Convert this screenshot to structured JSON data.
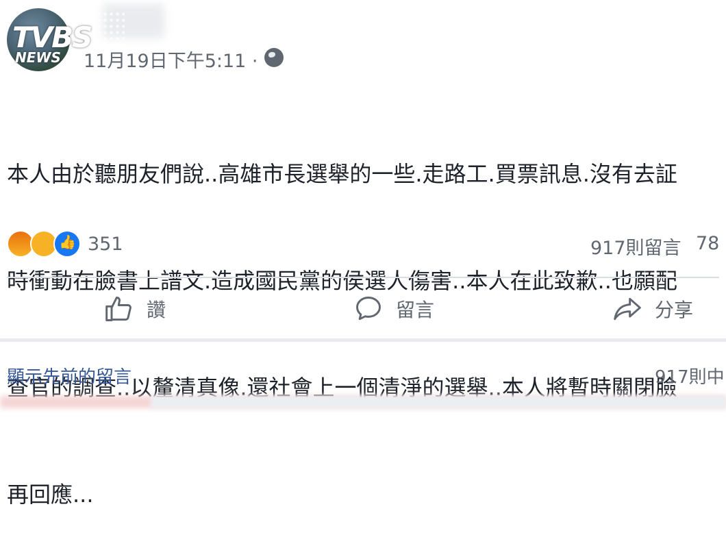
{
  "watermark": {
    "line1": "TVBS",
    "line2": "NEWS"
  },
  "post": {
    "timestamp": "11月19日下午5:11 ·",
    "lines": [
      "本人由於聽朋友們說..高雄市長選舉的一些.走路工.買票訊息.沒有去証",
      "時衝動在臉書上譜文.造成國民黨的侯選人傷害..本人在此致歉..也願配",
      "查官的調查..以釐清真像.還社會上一個清淨的選舉..本人將暫時關閉臉",
      "再回應..."
    ]
  },
  "stats": {
    "reaction_count": "351",
    "comment_count": "917則留言",
    "share_count": "78"
  },
  "actions": {
    "like": "讚",
    "comment": "留言",
    "share": "分享"
  },
  "comments": {
    "show_previous": "顯示先前的留言",
    "count": "917則中"
  },
  "icons": {
    "globe": "globe-icon",
    "like": "thumbs-up-icon",
    "comment": "comment-bubble-icon",
    "share": "share-arrow-icon"
  },
  "colors": {
    "like_reaction": "#1877f2",
    "haha_reaction": "#f7b125",
    "angry_reaction": "#e9710f",
    "link": "#365899",
    "muted": "#606770"
  }
}
